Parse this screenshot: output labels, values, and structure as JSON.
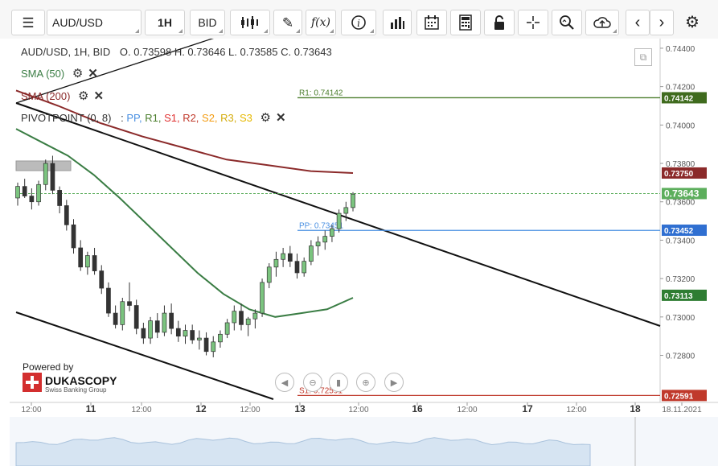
{
  "toolbar": {
    "instrument": "AUD/USD",
    "timeframe": "1H",
    "side": "BID",
    "icons": [
      "menu-icon",
      "candles-icon",
      "pencil-icon",
      "function-icon",
      "info-icon",
      "bar-chart-icon",
      "calendar-icon",
      "calculator-icon",
      "lock-icon",
      "crosshair-icon",
      "zoom-icon",
      "cloud-upload-icon",
      "chevron-left-icon",
      "chevron-right-icon",
      "gear-icon"
    ]
  },
  "legend": {
    "header": "AUD/USD, 1H, BID",
    "ohlc": "O. 0.73598 H. 0.73646 L. 0.73585 C. 0.73643",
    "sma50": "SMA (50)",
    "sma200": "SMA (200)",
    "pivot": "PIVOTPOINT (0, 8)",
    "pivot_sep": ":",
    "pivot_items": [
      {
        "label": "PP,",
        "color": "#4a90e2"
      },
      {
        "label": "R1,",
        "color": "#4a7d2b"
      },
      {
        "label": "S1,",
        "color": "#e03030"
      },
      {
        "label": "R2,",
        "color": "#c0392b"
      },
      {
        "label": "S2,",
        "color": "#f39c12"
      },
      {
        "label": "R3,",
        "color": "#d4ac0d"
      },
      {
        "label": "S3",
        "color": "#e6b800"
      }
    ]
  },
  "levels": {
    "r1": "R1: 0.74142",
    "pp": "PP: 0.73451",
    "s1": "S1: 0.72591"
  },
  "price_badges": [
    {
      "value": "0.74142",
      "price": 0.74142,
      "color": "#3f6b1e"
    },
    {
      "value": "0.73750",
      "price": 0.7375,
      "color": "#8b2a2a"
    },
    {
      "value": "0.73643",
      "price": 0.73643,
      "color": "#5cae5c"
    },
    {
      "value": "0.73452",
      "price": 0.73452,
      "color": "#2f6fd1"
    },
    {
      "value": "0.73113",
      "price": 0.73113,
      "color": "#2e7d32"
    },
    {
      "value": "0.72591",
      "price": 0.72591,
      "color": "#c0392b"
    }
  ],
  "branding": {
    "powered": "Powered by",
    "brand": "DUKASCOPY",
    "tagline": "Swiss Banking Group"
  },
  "chart_data": {
    "type": "candlestick",
    "title": "AUD/USD, 1H, BID",
    "y_ticks": [
      "0.74400",
      "0.74200",
      "0.74000",
      "0.73800",
      "0.73600",
      "0.73400",
      "0.73200",
      "0.73000",
      "0.72800"
    ],
    "y_tick_values": [
      0.744,
      0.742,
      0.74,
      0.738,
      0.736,
      0.734,
      0.732,
      0.73,
      0.728
    ],
    "ylim": [
      0.7258,
      0.7445
    ],
    "x_ticks": [
      "12:00",
      "11",
      "12:00",
      "12",
      "12:00",
      "13",
      "12:00",
      "16",
      "12:00",
      "17",
      "12:00",
      "18",
      "18.11.2021"
    ],
    "last_close": 0.73643,
    "sma50_last": 0.73113,
    "sma200_last": 0.7375,
    "grid": false,
    "series": [
      {
        "name": "SMA (50)",
        "color": "#3a7d44",
        "values": [
          0.7398,
          0.7391,
          0.7384,
          0.7374,
          0.7362,
          0.7349,
          0.7336,
          0.7323,
          0.7312,
          0.7304,
          0.73,
          0.7302,
          0.7304,
          0.731
        ]
      },
      {
        "name": "SMA (200)",
        "color": "#8b2a2a",
        "values": [
          0.7418,
          0.741,
          0.7401,
          0.7394,
          0.7388,
          0.7382,
          0.7379,
          0.7376,
          0.7375
        ]
      }
    ],
    "candles_ohlc": [
      [
        0.7362,
        0.737,
        0.7358,
        0.7368
      ],
      [
        0.7368,
        0.7372,
        0.7362,
        0.7363
      ],
      [
        0.7363,
        0.7367,
        0.7356,
        0.736
      ],
      [
        0.736,
        0.7371,
        0.7358,
        0.7369
      ],
      [
        0.7369,
        0.7382,
        0.7366,
        0.738
      ],
      [
        0.738,
        0.7384,
        0.7364,
        0.7366
      ],
      [
        0.7366,
        0.7368,
        0.7354,
        0.7358
      ],
      [
        0.7358,
        0.7361,
        0.7345,
        0.7348
      ],
      [
        0.7348,
        0.7351,
        0.7333,
        0.7336
      ],
      [
        0.7336,
        0.734,
        0.7324,
        0.7326
      ],
      [
        0.7326,
        0.7334,
        0.7322,
        0.7332
      ],
      [
        0.7332,
        0.7336,
        0.7322,
        0.7324
      ],
      [
        0.7324,
        0.7327,
        0.7312,
        0.7315
      ],
      [
        0.7315,
        0.7318,
        0.73,
        0.7302
      ],
      [
        0.7302,
        0.7306,
        0.7294,
        0.7296
      ],
      [
        0.7296,
        0.731,
        0.7293,
        0.7308
      ],
      [
        0.7308,
        0.7318,
        0.7303,
        0.7306
      ],
      [
        0.7306,
        0.7309,
        0.7291,
        0.7294
      ],
      [
        0.7294,
        0.7297,
        0.7286,
        0.7289
      ],
      [
        0.7289,
        0.73,
        0.7286,
        0.7298
      ],
      [
        0.7298,
        0.7302,
        0.7289,
        0.7292
      ],
      [
        0.7292,
        0.7306,
        0.729,
        0.7302
      ],
      [
        0.7302,
        0.7307,
        0.7291,
        0.7294
      ],
      [
        0.7294,
        0.7298,
        0.7287,
        0.729
      ],
      [
        0.729,
        0.7296,
        0.7286,
        0.7293
      ],
      [
        0.7293,
        0.7296,
        0.7286,
        0.7288
      ],
      [
        0.7288,
        0.7293,
        0.7283,
        0.7289
      ],
      [
        0.7289,
        0.7292,
        0.728,
        0.7282
      ],
      [
        0.7282,
        0.729,
        0.7279,
        0.7287
      ],
      [
        0.7287,
        0.7293,
        0.7284,
        0.7291
      ],
      [
        0.7291,
        0.7299,
        0.7289,
        0.7297
      ],
      [
        0.7297,
        0.7306,
        0.7293,
        0.7303
      ],
      [
        0.7303,
        0.7307,
        0.7293,
        0.7296
      ],
      [
        0.7296,
        0.73,
        0.729,
        0.7299
      ],
      [
        0.7299,
        0.7304,
        0.7294,
        0.7302
      ],
      [
        0.7302,
        0.732,
        0.73,
        0.7318
      ],
      [
        0.7318,
        0.7328,
        0.7315,
        0.7326
      ],
      [
        0.7326,
        0.7334,
        0.7321,
        0.733
      ],
      [
        0.733,
        0.7336,
        0.7326,
        0.7333
      ],
      [
        0.7333,
        0.7337,
        0.7326,
        0.7329
      ],
      [
        0.7329,
        0.7333,
        0.732,
        0.7323
      ],
      [
        0.7323,
        0.7331,
        0.7321,
        0.7329
      ],
      [
        0.7329,
        0.734,
        0.7327,
        0.7337
      ],
      [
        0.7337,
        0.7342,
        0.7332,
        0.7339
      ],
      [
        0.7339,
        0.7345,
        0.7335,
        0.7342
      ],
      [
        0.7342,
        0.7348,
        0.7339,
        0.7346
      ],
      [
        0.7346,
        0.7356,
        0.7344,
        0.7354
      ],
      [
        0.7354,
        0.736,
        0.735,
        0.7357
      ],
      [
        0.7357,
        0.7365,
        0.7355,
        0.7364
      ]
    ]
  }
}
